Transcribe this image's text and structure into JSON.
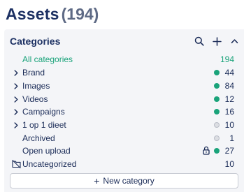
{
  "page": {
    "title": "Assets",
    "count": "(194)"
  },
  "categories_panel": {
    "title": "Categories",
    "icons": {
      "search": "search-icon",
      "add": "plus-icon",
      "collapse": "chevron-up-icon"
    },
    "all": {
      "label": "All categories",
      "count": "194"
    },
    "items": [
      {
        "label": "Brand",
        "count": "44",
        "expandable": true,
        "status": "green"
      },
      {
        "label": "Images",
        "count": "84",
        "expandable": true,
        "status": "green"
      },
      {
        "label": "Videos",
        "count": "12",
        "expandable": true,
        "status": "green"
      },
      {
        "label": "Campaigns",
        "count": "16",
        "expandable": true,
        "status": "green"
      },
      {
        "label": "1 op 1 dieet",
        "count": "10",
        "expandable": true,
        "status": "grey"
      },
      {
        "label": "Archived",
        "count": "1",
        "expandable": false,
        "status": "grey"
      },
      {
        "label": "Open upload",
        "count": "27",
        "expandable": false,
        "status": "green",
        "locked": true
      }
    ],
    "uncategorized": {
      "label": "Uncategorized",
      "count": "10"
    },
    "new_category_label": "New category"
  },
  "colors": {
    "accent": "#1aa37a",
    "text": "#1a2b57",
    "title": "#1d3163",
    "count_muted": "#5e6a85",
    "panel_bg": "#f4f5f8",
    "dot_off": "#dcdee3"
  }
}
